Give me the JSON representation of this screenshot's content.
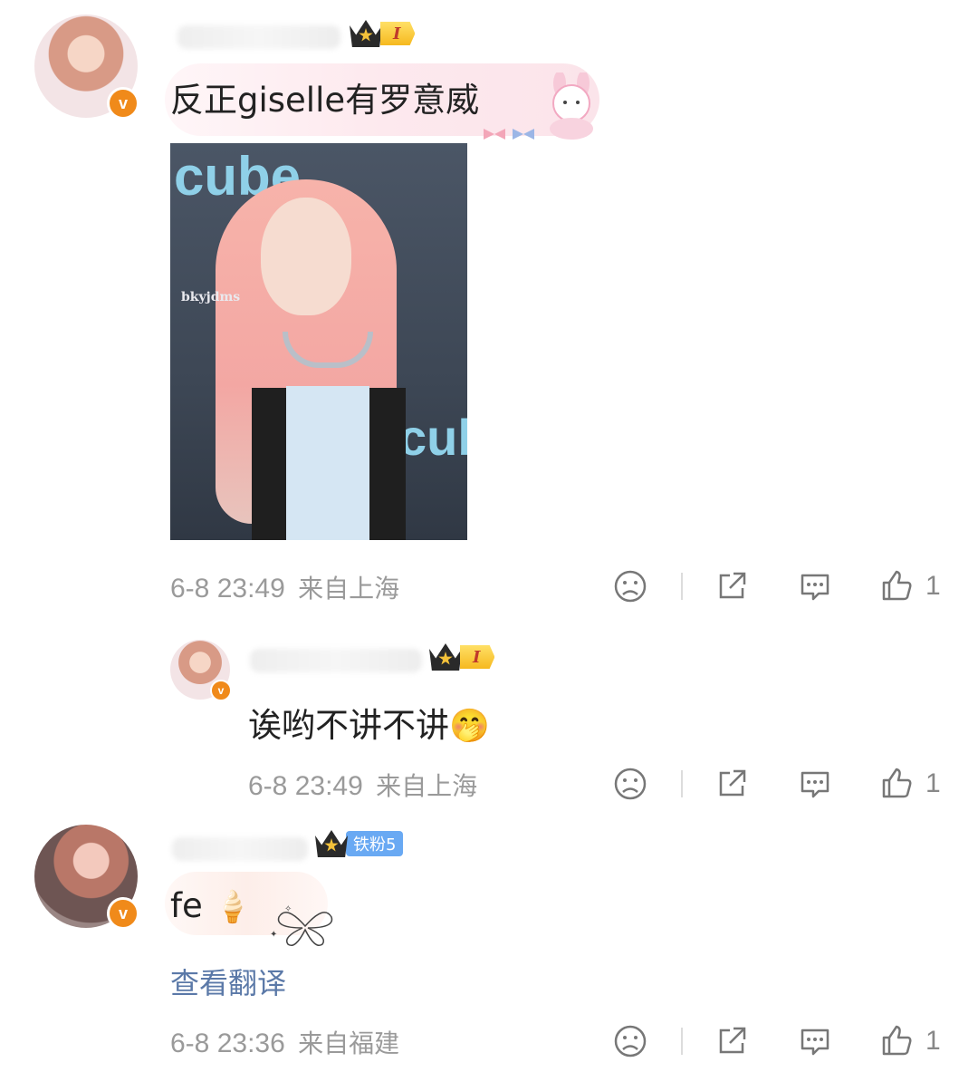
{
  "comments": [
    {
      "level_badge": "I",
      "text": "反正giselle有罗意威",
      "photo_watermark": "bkyjdms",
      "photo_logo": "cube",
      "time": "6-8 23:49",
      "location": "来自上海",
      "likes": "1"
    },
    {
      "level_badge": "I",
      "text": "诶哟不讲不讲",
      "emoji": "🤭",
      "time": "6-8 23:49",
      "location": "来自上海",
      "likes": "1"
    },
    {
      "fan_badge": "铁粉5",
      "text": "fe",
      "emoji": "🍦",
      "translate_link": "查看翻译",
      "time": "6-8 23:36",
      "location": "来自福建",
      "likes": "1"
    }
  ],
  "icons": [
    "sad-face-icon",
    "share-icon",
    "comment-icon",
    "thumb-up-icon",
    "verified-v-icon",
    "crown-icon"
  ],
  "colors": {
    "verified": "#f08a1a",
    "fan_badge": "#69a9f3",
    "translate": "#5b79a8",
    "meta": "#9a9a9a"
  }
}
